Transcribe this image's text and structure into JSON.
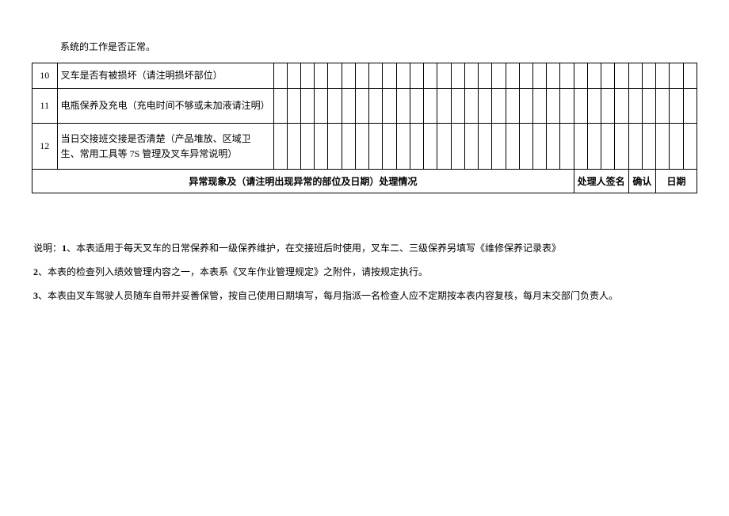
{
  "pre_text": "系统的工作是否正常。",
  "rows": [
    {
      "num": "10",
      "desc": "叉车是否有被损坏（请注明损坏部位）"
    },
    {
      "num": "11",
      "desc": "电瓶保养及充电（充电时间不够或未加液请注明）"
    },
    {
      "num": "12",
      "desc": "当日交接班交接是否清楚（产品堆放、区域卫生、常用工具等 7S 管理及叉车异常说明）"
    }
  ],
  "footer": {
    "col1": "异常现象及（请注明出现异常的部位及日期）处理情况",
    "col2": "处理人签名",
    "col3": "确认",
    "col4": "日期"
  },
  "notes": {
    "p1_prefix": "说明：",
    "p1_num": "1",
    "p1_text": "、本表适用于每天叉车的日常保养和一级保养维护，在交接班后时使用，叉车二、三级保养另填写《维修保养记录表》",
    "p2_num": "2",
    "p2_text": "、本表的检查列入绩效管理内容之一，本表系《叉车作业管理规定》之附件，请按规定执行。",
    "p3_num": "3",
    "p3_text": "、本表由叉车驾驶人员随车自带并妥善保管，按自己使用日期填写，每月指派一名检查人应不定期按本表内容复核，每月末交部门负责人。"
  }
}
